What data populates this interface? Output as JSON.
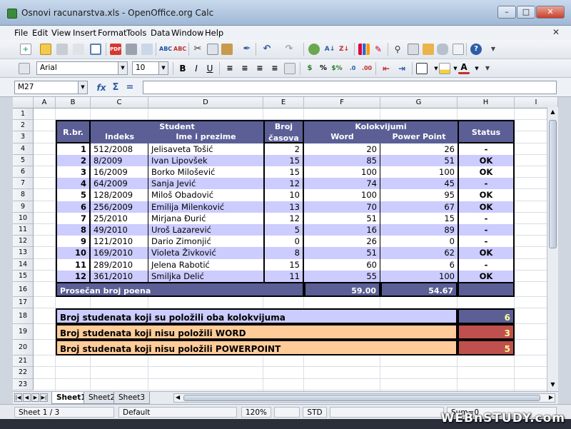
{
  "window": {
    "title": "Osnovi racunarstva.xls - OpenOffice.org Calc"
  },
  "menu": [
    "File",
    "Edit",
    "View",
    "Insert",
    "Format",
    "Tools",
    "Data",
    "Window",
    "Help"
  ],
  "formatting": {
    "font_name": "Arial",
    "font_size": "10"
  },
  "formula_bar": {
    "cell_ref": "M27",
    "content": ""
  },
  "columns": [
    "A",
    "B",
    "C",
    "D",
    "E",
    "F",
    "G",
    "H",
    "I"
  ],
  "rows": [
    "1",
    "2",
    "3",
    "4",
    "5",
    "6",
    "7",
    "8",
    "9",
    "10",
    "11",
    "12",
    "13",
    "14",
    "15",
    "16",
    "17",
    "18",
    "19",
    "20",
    "21",
    "22",
    "23"
  ],
  "table": {
    "header": {
      "rbr": "R.br.",
      "student": "Student",
      "indeks": "Indeks",
      "ime": "Ime i prezime",
      "broj": "Broj",
      "casova": "časova",
      "kolokvijumi": "Kolokvijumi",
      "word": "Word",
      "pp": "Power Point",
      "status": "Status"
    },
    "rows": [
      {
        "n": "1",
        "indeks": "512/2008",
        "ime": "Jelisaveta Tošić",
        "casova": "2",
        "word": "20",
        "pp": "26",
        "status": "-"
      },
      {
        "n": "2",
        "indeks": "8/2009",
        "ime": "Ivan Lipovšek",
        "casova": "15",
        "word": "85",
        "pp": "51",
        "status": "OK"
      },
      {
        "n": "3",
        "indeks": "16/2009",
        "ime": "Borko Milošević",
        "casova": "15",
        "word": "100",
        "pp": "100",
        "status": "OK"
      },
      {
        "n": "4",
        "indeks": "64/2009",
        "ime": "Sanja Jević",
        "casova": "12",
        "word": "74",
        "pp": "45",
        "status": "-"
      },
      {
        "n": "5",
        "indeks": "128/2009",
        "ime": "Miloš Obadović",
        "casova": "10",
        "word": "100",
        "pp": "95",
        "status": "OK"
      },
      {
        "n": "6",
        "indeks": "256/2009",
        "ime": "Emilija Milenković",
        "casova": "13",
        "word": "70",
        "pp": "67",
        "status": "OK"
      },
      {
        "n": "7",
        "indeks": "25/2010",
        "ime": "Mirjana Đurić",
        "casova": "12",
        "word": "51",
        "pp": "15",
        "status": "-"
      },
      {
        "n": "8",
        "indeks": "49/2010",
        "ime": "Uroš Lazarević",
        "casova": "5",
        "word": "16",
        "pp": "89",
        "status": "-"
      },
      {
        "n": "9",
        "indeks": "121/2010",
        "ime": "Dario Zimonjić",
        "casova": "0",
        "word": "26",
        "pp": "0",
        "status": "-"
      },
      {
        "n": "10",
        "indeks": "169/2010",
        "ime": "Violeta Živković",
        "casova": "8",
        "word": "51",
        "pp": "62",
        "status": "OK"
      },
      {
        "n": "11",
        "indeks": "289/2010",
        "ime": "Jelena Rabotić",
        "casova": "15",
        "word": "60",
        "pp": "6",
        "status": "-"
      },
      {
        "n": "12",
        "indeks": "361/2010",
        "ime": "Smiljka Delić",
        "casova": "11",
        "word": "55",
        "pp": "100",
        "status": "OK"
      }
    ],
    "average": {
      "label": "Prosečan broj poena",
      "word": "59.00",
      "pp": "54.67"
    }
  },
  "summary": [
    {
      "label": "Broj studenata koji su položili oba kolokvijuma",
      "value": "6",
      "bg": "#ccccff",
      "vbg": "#5b5f96"
    },
    {
      "label": "Broj studenata koji nisu položili WORD",
      "value": "3",
      "bg": "#ffcc99",
      "vbg": "#c0504d"
    },
    {
      "label": "Broj studenata koji nisu položili POWERPOINT",
      "value": "5",
      "bg": "#ffcc99",
      "vbg": "#c0504d"
    }
  ],
  "sheets": [
    "Sheet1",
    "Sheet2",
    "Sheet3"
  ],
  "status": {
    "sheet": "Sheet 1 / 3",
    "style": "Default",
    "zoom": "120%",
    "mode": "STD",
    "sum": "Sum=0"
  },
  "watermark": "WEBnSTUDY.com"
}
